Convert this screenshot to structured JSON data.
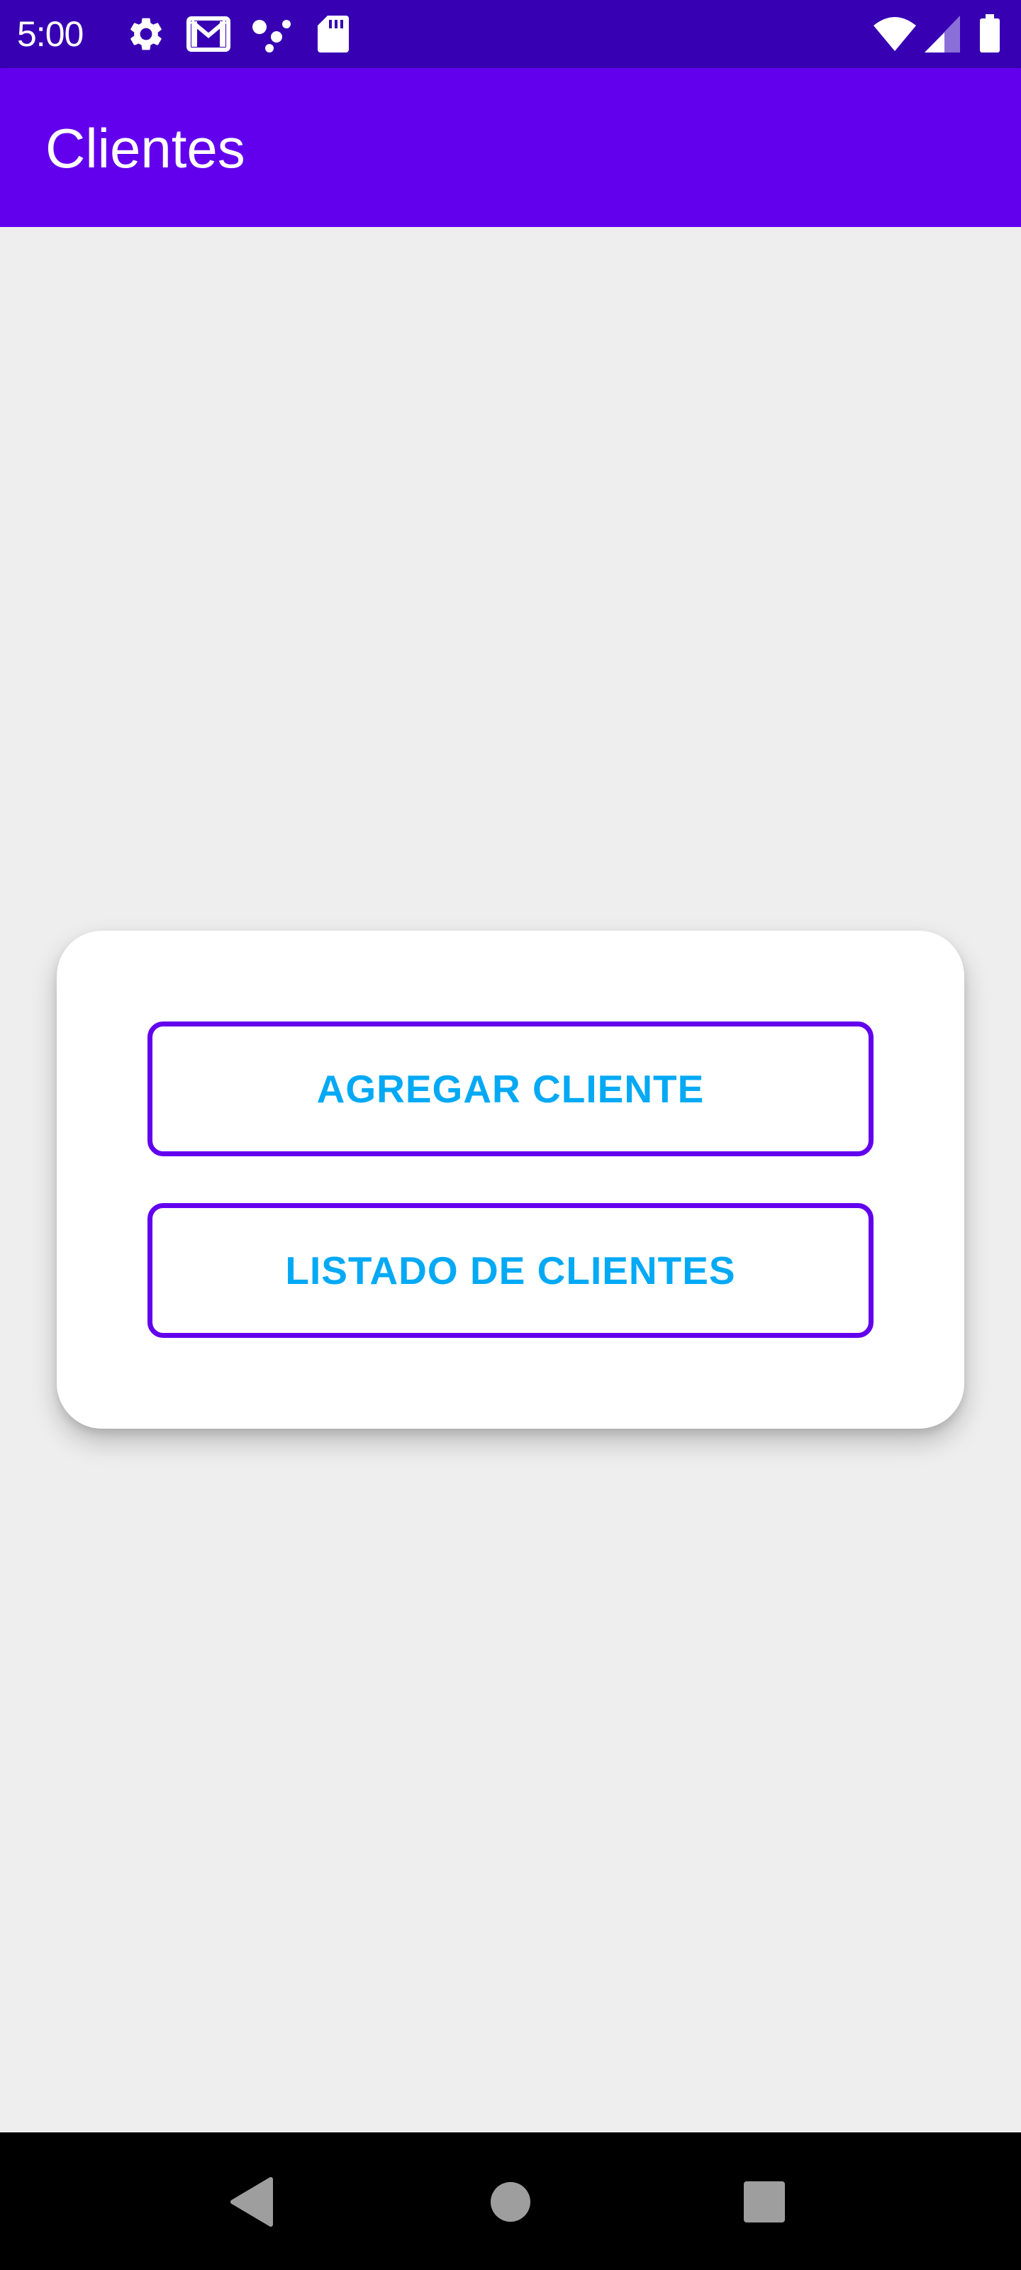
{
  "status_bar": {
    "time": "5:00",
    "icons": [
      "settings-gear-icon",
      "gmail-icon",
      "dots-network-icon",
      "sd-card-icon",
      "wifi-icon",
      "cell-signal-icon",
      "battery-icon"
    ]
  },
  "app_bar": {
    "title": "Clientes",
    "color": "#6200EE"
  },
  "menu": {
    "add_client_label": "AGREGAR CLIENTE",
    "client_list_label": "LISTADO DE CLIENTES",
    "button_text_color": "#03A9F4",
    "button_border_color": "#6200EE"
  },
  "nav_bar": {
    "icons": [
      "back-icon",
      "home-icon",
      "recents-icon"
    ]
  }
}
